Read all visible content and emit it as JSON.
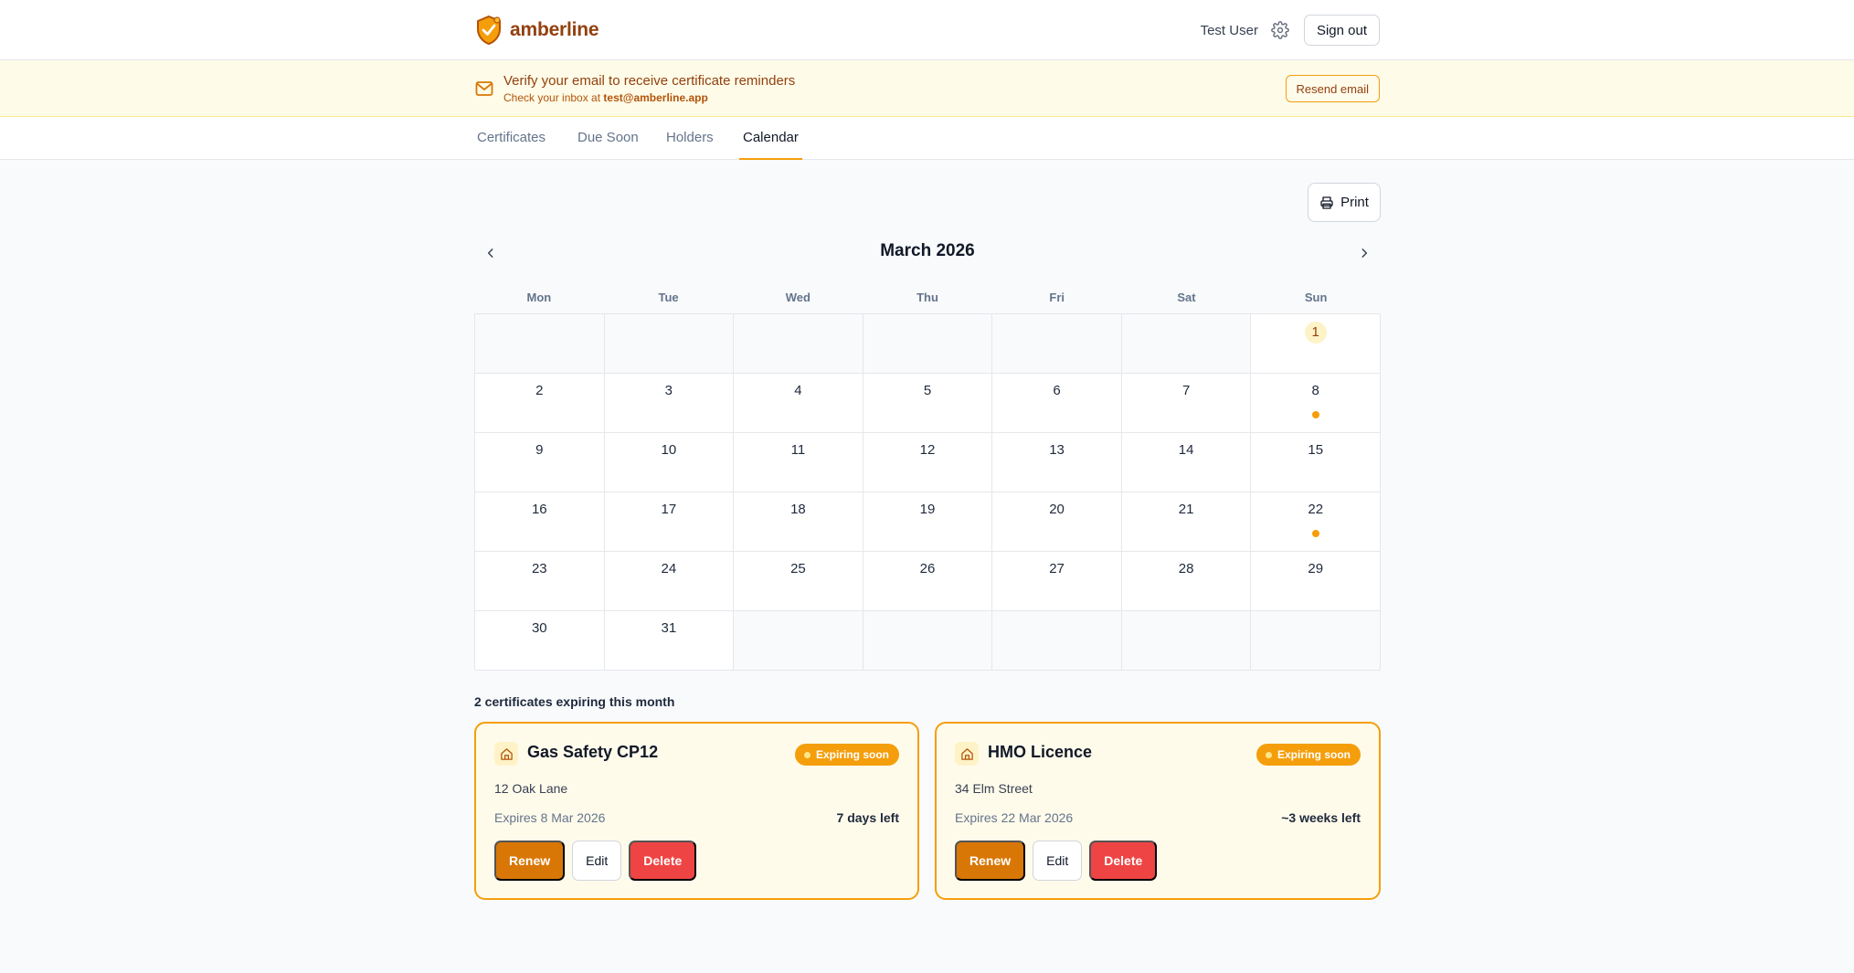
{
  "header": {
    "brand": "amberline",
    "user_name": "Test User",
    "signout_label": "Sign out"
  },
  "banner": {
    "title": "Verify your email to receive certificate reminders",
    "sub_prefix": "Check your inbox at",
    "email": "test@amberline.app",
    "resend_label": "Resend email"
  },
  "tabs": [
    {
      "label": "Certificates",
      "active": false
    },
    {
      "label": "Due Soon",
      "active": false
    },
    {
      "label": "Holders",
      "active": false
    },
    {
      "label": "Calendar",
      "active": true
    }
  ],
  "toolbar": {
    "print_label": "Print"
  },
  "calendar": {
    "month_label": "March 2026",
    "weekdays": [
      "Mon",
      "Tue",
      "Wed",
      "Thu",
      "Fri",
      "Sat",
      "Sun"
    ],
    "today": 1,
    "rows": [
      [
        "",
        "",
        "",
        "",
        "",
        "",
        "1"
      ],
      [
        "2",
        "3",
        "4",
        "5",
        "6",
        "7",
        "8"
      ],
      [
        "9",
        "10",
        "11",
        "12",
        "13",
        "14",
        "15"
      ],
      [
        "16",
        "17",
        "18",
        "19",
        "20",
        "21",
        "22"
      ],
      [
        "23",
        "24",
        "25",
        "26",
        "27",
        "28",
        "29"
      ],
      [
        "30",
        "31",
        "",
        "",
        "",
        "",
        ""
      ]
    ],
    "event_days": [
      "8",
      "22"
    ]
  },
  "list": {
    "title": "2 certificates expiring this month",
    "cards": [
      {
        "name": "Gas Safety CP12",
        "badge": "Expiring soon",
        "address": "12 Oak Lane",
        "expires": "Expires 8 Mar 2026",
        "left": "7 days left",
        "renew": "Renew",
        "edit": "Edit",
        "delete": "Delete"
      },
      {
        "name": "HMO Licence",
        "badge": "Expiring soon",
        "address": "34 Elm Street",
        "expires": "Expires 22 Mar 2026",
        "left": "~3 weeks left",
        "renew": "Renew",
        "edit": "Edit",
        "delete": "Delete"
      }
    ]
  },
  "colors": {
    "accent": "#f59e0b",
    "brand": "#92400e",
    "danger": "#ef4444",
    "renew": "#d97706"
  }
}
